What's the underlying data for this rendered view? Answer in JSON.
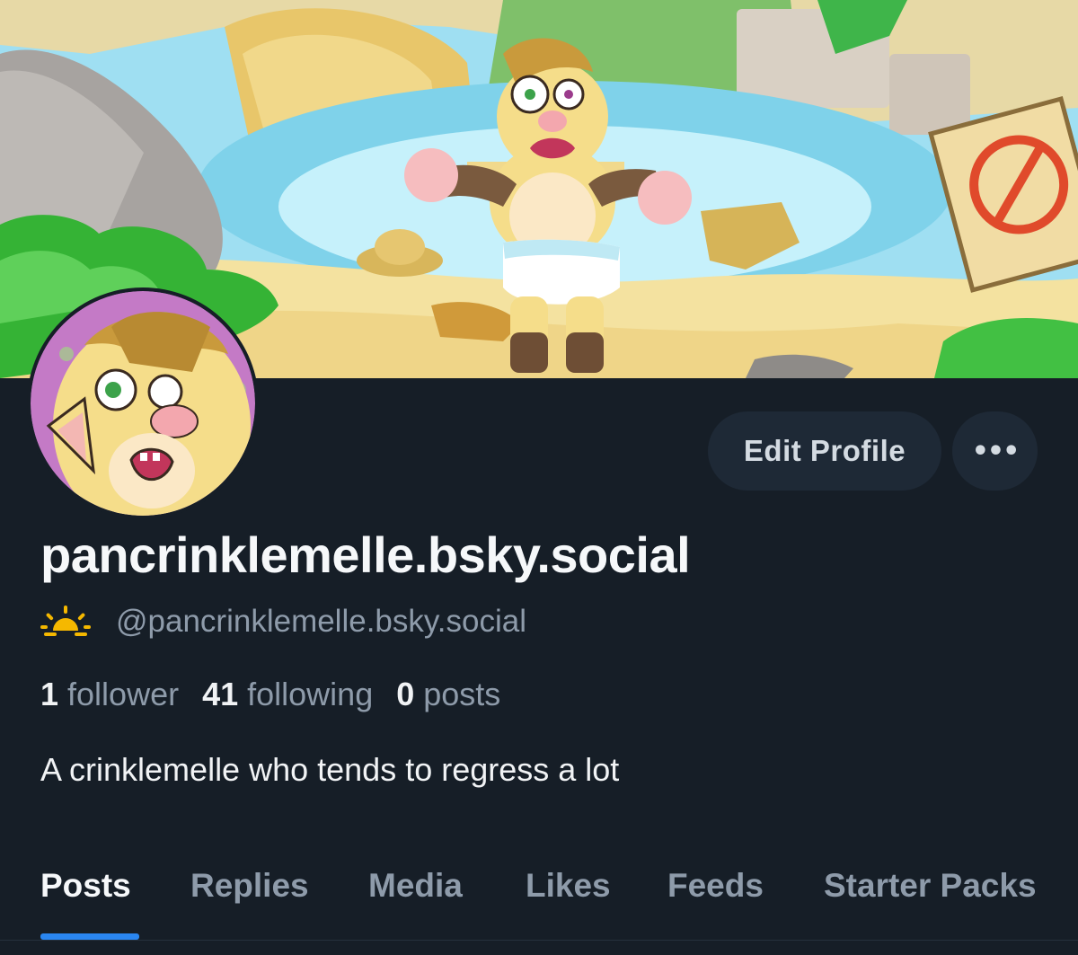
{
  "profile": {
    "display_name": "pancrinklemelle.bsky.social",
    "handle": "@pancrinklemelle.bsky.social",
    "bio": "A crinklemelle who tends to regress a lot",
    "handle_icon": "sunrise-icon"
  },
  "stats": {
    "followers": {
      "count": "1",
      "label": "follower"
    },
    "following": {
      "count": "41",
      "label": "following"
    },
    "posts": {
      "count": "0",
      "label": "posts"
    }
  },
  "actions": {
    "edit_profile_label": "Edit Profile",
    "more_label": "•••"
  },
  "tabs": [
    {
      "label": "Posts",
      "active": true
    },
    {
      "label": "Replies",
      "active": false
    },
    {
      "label": "Media",
      "active": false
    },
    {
      "label": "Likes",
      "active": false
    },
    {
      "label": "Feeds",
      "active": false
    },
    {
      "label": "Starter Packs",
      "active": false
    }
  ],
  "colors": {
    "background": "#161e27",
    "button_bg": "#1e2936",
    "accent": "#2a86f0",
    "muted_text": "#8e9baa",
    "sun_icon": "#f5b800"
  }
}
